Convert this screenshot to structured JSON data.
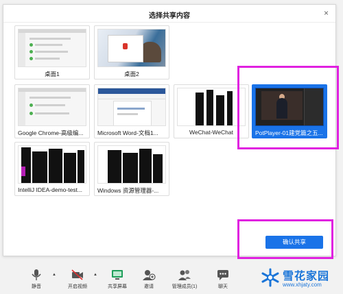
{
  "dialog": {
    "title": "选择共享内容",
    "close_glyph": "×",
    "confirm_label": "确认共享"
  },
  "tiles": [
    {
      "label": "桌面1"
    },
    {
      "label": "桌面2"
    },
    {
      "label": "Google Chrome-高级编..."
    },
    {
      "label": "Microsoft Word-文档1..."
    },
    {
      "label": "WeChat-WeChat"
    },
    {
      "label": "PotPlayer-01建党篇之五..."
    },
    {
      "label": "IntelliJ IDEA-demo-test..."
    },
    {
      "label": "Windows 资源管理器-..."
    }
  ],
  "selected_tile": "PotPlayer-01建党篇之五...",
  "toolbar": {
    "mute": "静音",
    "video": "开启视频",
    "share": "共享屏幕",
    "invite": "邀请",
    "members": "管理成员(1)",
    "chat": "聊天"
  },
  "watermark": {
    "brand": "雪花家园",
    "url": "www.xhjaty.com"
  },
  "colors": {
    "accent": "#1a73e8",
    "highlight": "#e020e0",
    "watermark": "#1b75d8"
  }
}
